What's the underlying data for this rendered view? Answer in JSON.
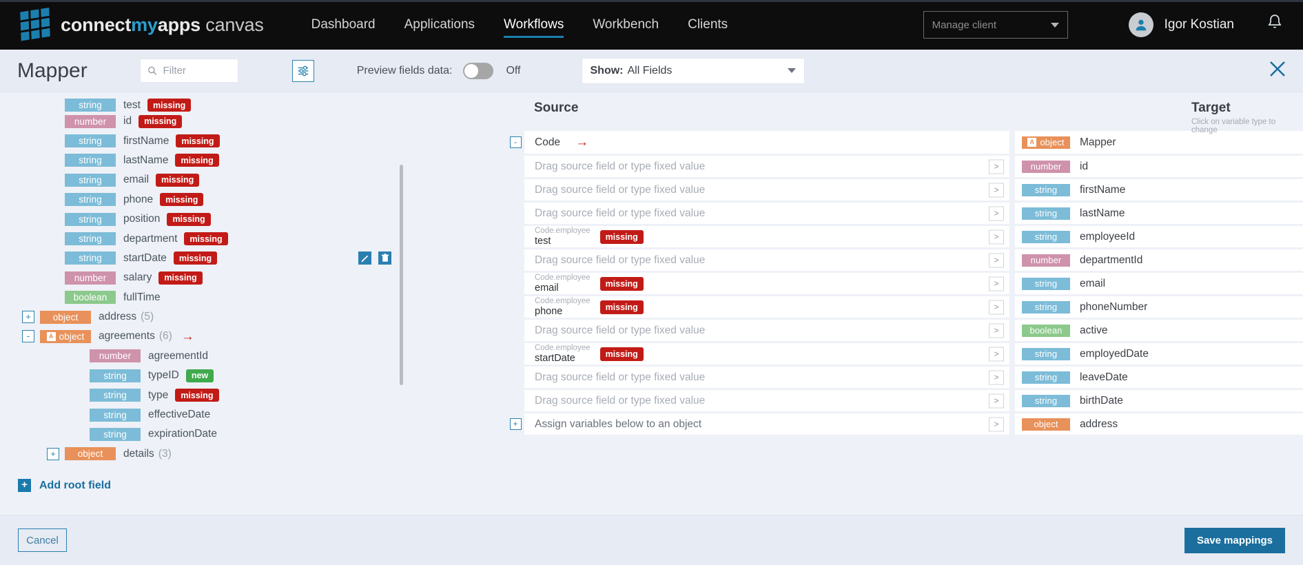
{
  "nav": {
    "brand": {
      "part1": "connect",
      "part2": "my",
      "part3": "apps",
      "part4": "canvas"
    },
    "items": [
      {
        "label": "Dashboard",
        "active": false
      },
      {
        "label": "Applications",
        "active": false
      },
      {
        "label": "Workflows",
        "active": true
      },
      {
        "label": "Workbench",
        "active": false
      },
      {
        "label": "Clients",
        "active": false
      }
    ],
    "client_select": {
      "placeholder": "Manage client"
    },
    "user": {
      "name": "Igor Kostian"
    }
  },
  "toolbar": {
    "title": "Mapper",
    "filter": {
      "value": "",
      "placeholder": "Filter"
    },
    "preview_label": "Preview fields data:",
    "toggle_state": "Off",
    "show_label": "Show:",
    "show_value": "All Fields"
  },
  "tree": {
    "rows": [
      {
        "indent": 1,
        "type": "string",
        "name": "test",
        "tag": "missing",
        "clipped": true
      },
      {
        "indent": 1,
        "type": "number",
        "name": "id",
        "tag": "missing"
      },
      {
        "indent": 1,
        "type": "string",
        "name": "firstName",
        "tag": "missing"
      },
      {
        "indent": 1,
        "type": "string",
        "name": "lastName",
        "tag": "missing"
      },
      {
        "indent": 1,
        "type": "string",
        "name": "email",
        "tag": "missing"
      },
      {
        "indent": 1,
        "type": "string",
        "name": "phone",
        "tag": "missing"
      },
      {
        "indent": 1,
        "type": "string",
        "name": "position",
        "tag": "missing"
      },
      {
        "indent": 1,
        "type": "string",
        "name": "department",
        "tag": "missing"
      },
      {
        "indent": 1,
        "type": "string",
        "name": "startDate",
        "tag": "missing",
        "actions": true
      },
      {
        "indent": 1,
        "type": "number",
        "name": "salary",
        "tag": "missing"
      },
      {
        "indent": 1,
        "type": "boolean",
        "name": "fullTime",
        "tag": ""
      },
      {
        "indent": 0,
        "type": "object",
        "name": "address",
        "tag": "",
        "count": "(5)",
        "expander": "+"
      },
      {
        "indent": 0,
        "type": "object",
        "name": "agreements",
        "tag": "",
        "count": "(6)",
        "expander": "-",
        "objmark": "A",
        "arrow": true
      },
      {
        "indent": 2,
        "type": "number",
        "name": "agreementId",
        "tag": ""
      },
      {
        "indent": 2,
        "type": "string",
        "name": "typeID",
        "tag": "new"
      },
      {
        "indent": 2,
        "type": "string",
        "name": "type",
        "tag": "missing"
      },
      {
        "indent": 2,
        "type": "string",
        "name": "effectiveDate",
        "tag": ""
      },
      {
        "indent": 2,
        "type": "string",
        "name": "expirationDate",
        "tag": ""
      },
      {
        "indent": 1,
        "type": "object",
        "name": "details",
        "tag": "",
        "count": "(3)",
        "expander": "+"
      }
    ],
    "add_root_label": "Add root field"
  },
  "mapping": {
    "source_header": "Source",
    "target_header": "Target",
    "target_sub": "Click on variable type to change",
    "placeholder": "Drag source field or type fixed value",
    "chevron": ">",
    "rows": [
      {
        "kind": "title",
        "expander": "-",
        "src_code": "Code",
        "arrow": true,
        "tgt_type": "object",
        "tgt_name": "Mapper",
        "objmark": "A"
      },
      {
        "kind": "field",
        "src_path": "",
        "src_value": "",
        "src_tag": "",
        "tgt_type": "number",
        "tgt_name": "id"
      },
      {
        "kind": "field",
        "src_path": "",
        "src_value": "",
        "src_tag": "",
        "tgt_type": "string",
        "tgt_name": "firstName"
      },
      {
        "kind": "field",
        "src_path": "",
        "src_value": "",
        "src_tag": "",
        "tgt_type": "string",
        "tgt_name": "lastName"
      },
      {
        "kind": "field",
        "src_path": "Code.employee",
        "src_value": "test",
        "src_tag": "missing",
        "tgt_type": "string",
        "tgt_name": "employeeId"
      },
      {
        "kind": "field",
        "src_path": "",
        "src_value": "",
        "src_tag": "",
        "tgt_type": "number",
        "tgt_name": "departmentId"
      },
      {
        "kind": "field",
        "src_path": "Code.employee",
        "src_value": "email",
        "src_tag": "missing",
        "tgt_type": "string",
        "tgt_name": "email"
      },
      {
        "kind": "field",
        "src_path": "Code.employee",
        "src_value": "phone",
        "src_tag": "missing",
        "tgt_type": "string",
        "tgt_name": "phoneNumber"
      },
      {
        "kind": "field",
        "src_path": "",
        "src_value": "",
        "src_tag": "",
        "tgt_type": "boolean",
        "tgt_name": "active"
      },
      {
        "kind": "field",
        "src_path": "Code.employee",
        "src_value": "startDate",
        "src_tag": "missing",
        "tgt_type": "string",
        "tgt_name": "employedDate"
      },
      {
        "kind": "field",
        "src_path": "",
        "src_value": "",
        "src_tag": "",
        "tgt_type": "string",
        "tgt_name": "leaveDate"
      },
      {
        "kind": "field",
        "src_path": "",
        "src_value": "",
        "src_tag": "",
        "tgt_type": "string",
        "tgt_name": "birthDate"
      },
      {
        "kind": "object",
        "expander": "+",
        "src_assign": "Assign variables below to an object",
        "tgt_type": "object",
        "tgt_name": "address"
      }
    ]
  },
  "footer": {
    "cancel_label": "Cancel",
    "save_label": "Save mappings"
  },
  "colors": {
    "accent": "#1a6f9e",
    "brand_blue": "#2a9fd0",
    "missing": "#c21b17",
    "new": "#3faa4e",
    "type_string": "#7cbcd8",
    "type_number": "#cf92ab",
    "type_boolean": "#8cc98c",
    "type_object": "#e8915a"
  }
}
